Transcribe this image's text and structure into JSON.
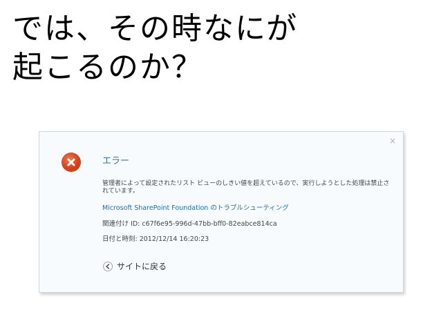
{
  "slide": {
    "title_line1": "では、その時なにが",
    "title_line2": "起こるのか？"
  },
  "dialog": {
    "close_label": "×",
    "icon": "error-icon",
    "title": "エラー",
    "message": "管理者によって設定されたリスト ビューのしきい値を超えているので、実行しようとした処理は禁止されています。",
    "troubleshoot_link": "Microsoft SharePoint Foundation のトラブルシューティング",
    "correlation": "関連付け ID: c67f6e95-996d-47bb-bff0-82eabce814ca",
    "datetime": "日付と時刻: 2012/12/14 16:20:23",
    "back_icon": "back-arrow-icon",
    "back_label": "サイトに戻る"
  },
  "colors": {
    "title_text": "#000000",
    "dialog_bg": "#f7fbfd",
    "error_red": "#d9411a",
    "heading_blue": "#3a6ea5",
    "link_blue": "#0f6fc6",
    "body_text": "#444444"
  }
}
